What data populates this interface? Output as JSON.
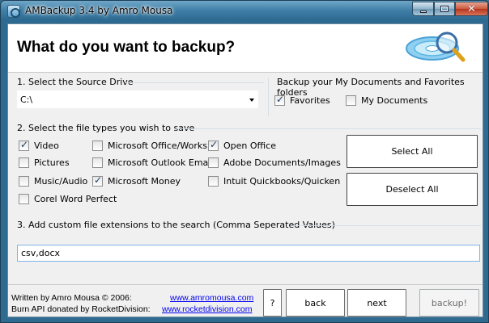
{
  "window": {
    "title": "AMBackup 3.4 by Amro Mousa"
  },
  "header": {
    "title": "What do you want to backup?",
    "logo_icon": "magnifier-disc-icon"
  },
  "source": {
    "label": "1.  Select the Source Drive",
    "drive_value": "C:\\"
  },
  "mydocs": {
    "label": "Backup your My Documents and Favorites folders",
    "favorites": {
      "label": "Favorites",
      "checked": true
    },
    "my_documents": {
      "label": "My Documents",
      "checked": false
    }
  },
  "filetypes": {
    "label": "2.  Select the file types you wish to save",
    "items": [
      {
        "label": "Video",
        "checked": true
      },
      {
        "label": "Pictures",
        "checked": false
      },
      {
        "label": "Music/Audio",
        "checked": false
      },
      {
        "label": "Corel Word Perfect",
        "checked": false
      },
      {
        "label": "Microsoft Office/Works",
        "checked": false
      },
      {
        "label": "Microsoft Outlook Email",
        "checked": false
      },
      {
        "label": "Microsoft Money",
        "checked": true
      },
      {
        "label": "Open Office",
        "checked": true
      },
      {
        "label": "Adobe Documents/Images",
        "checked": false
      },
      {
        "label": "Intuit Quickbooks/Quicken",
        "checked": false
      }
    ],
    "select_all": "Select All",
    "deselect_all": "Deselect All"
  },
  "custom": {
    "label": "3.  Add custom file extensions to the search (Comma Seperated Values)",
    "value": "csv,docx"
  },
  "footer": {
    "written_by": "Written by Amro Mousa © 2006:",
    "burn_api": "Burn API donated by RocketDivision:",
    "link1": "www.amromousa.com",
    "link2": "www.rocketdivision.com",
    "help": "?",
    "back": "back",
    "next": "next",
    "backup": "backup!"
  }
}
